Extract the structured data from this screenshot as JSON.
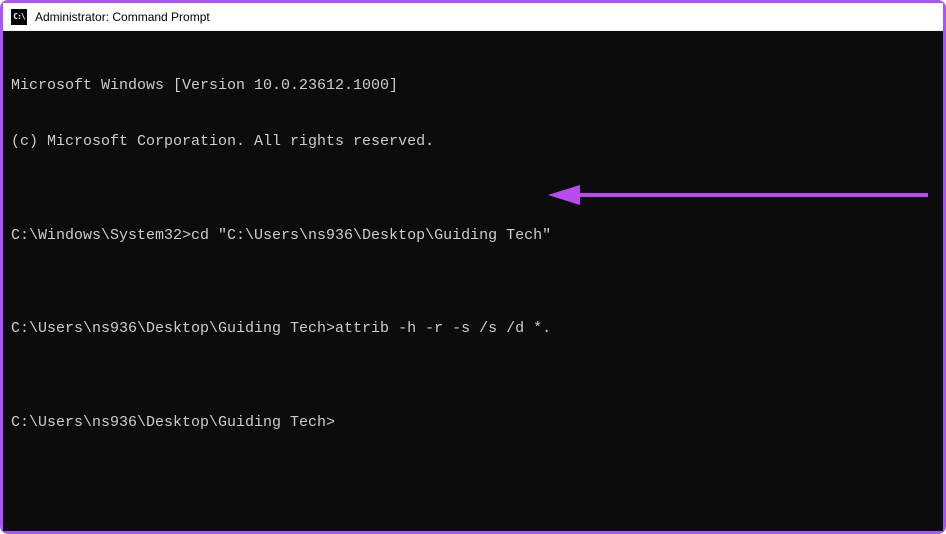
{
  "window": {
    "title": "Administrator: Command Prompt",
    "icon_label": "cmd-icon",
    "icon_text": "C:\\"
  },
  "terminal": {
    "lines": [
      "Microsoft Windows [Version 10.0.23612.1000]",
      "(c) Microsoft Corporation. All rights reserved.",
      "",
      "C:\\Windows\\System32>cd \"C:\\Users\\ns936\\Desktop\\Guiding Tech\"",
      "",
      "C:\\Users\\ns936\\Desktop\\Guiding Tech>attrib -h -r -s /s /d *.",
      "",
      "C:\\Users\\ns936\\Desktop\\Guiding Tech>"
    ]
  },
  "annotation": {
    "color": "#b84af0"
  }
}
